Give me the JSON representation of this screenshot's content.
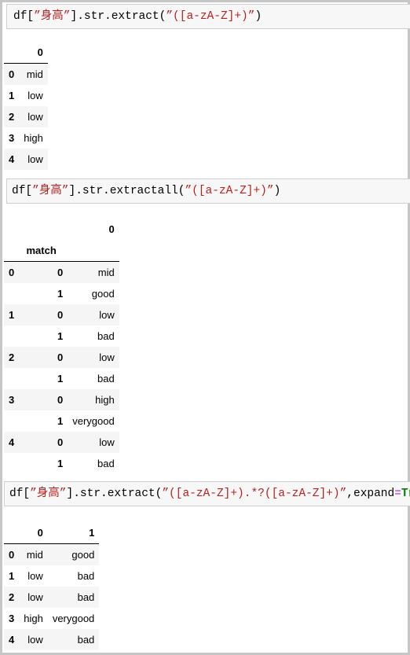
{
  "cells": [
    {
      "code": [
        {
          "t": "df[",
          "c": ""
        },
        {
          "t": "”身高”",
          "c": "s"
        },
        {
          "t": "].str.extract(",
          "c": ""
        },
        {
          "t": "”([a-zA-Z]+)”",
          "c": "s"
        },
        {
          "t": ")",
          "c": ""
        }
      ],
      "columns": [
        "0"
      ],
      "rows": [
        {
          "idx": "0",
          "v": [
            "mid"
          ]
        },
        {
          "idx": "1",
          "v": [
            "low"
          ]
        },
        {
          "idx": "2",
          "v": [
            "low"
          ]
        },
        {
          "idx": "3",
          "v": [
            "high"
          ]
        },
        {
          "idx": "4",
          "v": [
            "low"
          ]
        }
      ]
    },
    {
      "code": [
        {
          "t": "df[",
          "c": ""
        },
        {
          "t": "”身高”",
          "c": "s"
        },
        {
          "t": "].str.extractall(",
          "c": ""
        },
        {
          "t": "”([a-zA-Z]+)”",
          "c": "s"
        },
        {
          "t": ")",
          "c": ""
        }
      ],
      "columns": [
        "0"
      ],
      "index_name": "match",
      "rows": [
        {
          "idx": "0",
          "m": "0",
          "v": [
            "mid"
          ]
        },
        {
          "idx": "",
          "m": "1",
          "v": [
            "good"
          ]
        },
        {
          "idx": "1",
          "m": "0",
          "v": [
            "low"
          ]
        },
        {
          "idx": "",
          "m": "1",
          "v": [
            "bad"
          ]
        },
        {
          "idx": "2",
          "m": "0",
          "v": [
            "low"
          ]
        },
        {
          "idx": "",
          "m": "1",
          "v": [
            "bad"
          ]
        },
        {
          "idx": "3",
          "m": "0",
          "v": [
            "high"
          ]
        },
        {
          "idx": "",
          "m": "1",
          "v": [
            "verygood"
          ]
        },
        {
          "idx": "4",
          "m": "0",
          "v": [
            "low"
          ]
        },
        {
          "idx": "",
          "m": "1",
          "v": [
            "bad"
          ]
        }
      ]
    },
    {
      "code": [
        {
          "t": "df[",
          "c": ""
        },
        {
          "t": "”身高”",
          "c": "s"
        },
        {
          "t": "].str.extract(",
          "c": ""
        },
        {
          "t": "”([a-zA-Z]+).*?([a-zA-Z]+)”",
          "c": "s"
        },
        {
          "t": ",expand",
          "c": ""
        },
        {
          "t": "=",
          "c": "o"
        },
        {
          "t": "True",
          "c": "k"
        },
        {
          "t": ")",
          "c": ""
        }
      ],
      "columns": [
        "0",
        "1"
      ],
      "rows": [
        {
          "idx": "0",
          "v": [
            "mid",
            "good"
          ]
        },
        {
          "idx": "1",
          "v": [
            "low",
            "bad"
          ]
        },
        {
          "idx": "2",
          "v": [
            "low",
            "bad"
          ]
        },
        {
          "idx": "3",
          "v": [
            "high",
            "verygood"
          ]
        },
        {
          "idx": "4",
          "v": [
            "low",
            "bad"
          ]
        }
      ]
    }
  ]
}
